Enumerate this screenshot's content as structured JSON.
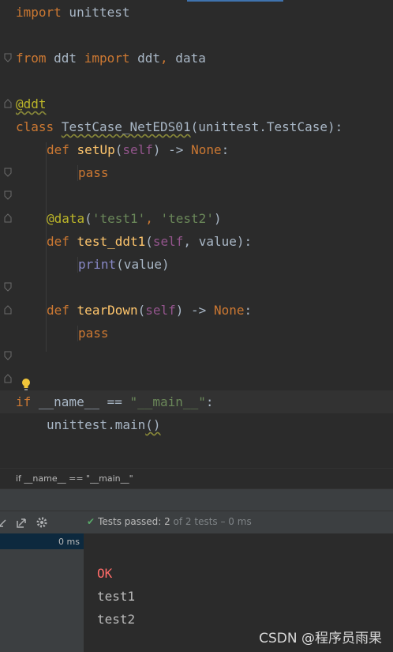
{
  "editor": {
    "lines": {
      "l1": {
        "import": "import",
        "module": " unittest"
      },
      "l3": {
        "from": "from",
        "mod": " ddt ",
        "import": "import",
        "names": " ddt",
        "comma": ",",
        "data": " data"
      },
      "l5": {
        "decorator": "@ddt"
      },
      "l6": {
        "class": "class",
        "name": "TestCase_NetEDS01",
        "base": "(unittest.TestCase):"
      },
      "l7": {
        "def": "def",
        "fn": "setUp",
        "open": "(",
        "self": "self",
        "rest": ") -> ",
        "none": "None",
        "colon": ":"
      },
      "l8": {
        "pass": "pass"
      },
      "l10": {
        "decorator": "@data",
        "open": "(",
        "s1": "'test1'",
        "comma": ", ",
        "s2": "'test2'",
        "close": ")"
      },
      "l11": {
        "def": "def",
        "fn": "test_ddt1",
        "open": "(",
        "self": "self",
        "rest": ", value):"
      },
      "l12": {
        "print": "print",
        "rest": "(value)"
      },
      "l14": {
        "def": "def",
        "fn": "tearDown",
        "open": "(",
        "self": "self",
        "rest": ") -> ",
        "none": "None",
        "colon": ":"
      },
      "l15": {
        "pass": "pass"
      },
      "l17": {
        "if": "if",
        "name": " __name__ == ",
        "str": "\"__main__\"",
        "colon": ":"
      },
      "l18": {
        "call": "unittest.main",
        "parens": "()"
      }
    }
  },
  "breadcrumb": {
    "text": "if __name__ == \"__main__\""
  },
  "run_toolbar": {
    "status_prefix": "Tests passed:",
    "passed": " 2",
    "total": " of 2 tests – 0 ms"
  },
  "test_tree": {
    "duration": "0 ms"
  },
  "console": {
    "ok": "OK",
    "line1": "test1",
    "line2": "test2"
  },
  "watermark": "CSDN @程序员雨果",
  "colors": {
    "background": "#2b2b2b",
    "keyword": "#cc7832",
    "decorator": "#bbb529",
    "function": "#ffc66d",
    "string": "#6a8759",
    "self": "#94558d",
    "pass_check": "#59a869",
    "ok_red": "#ff6b68"
  }
}
